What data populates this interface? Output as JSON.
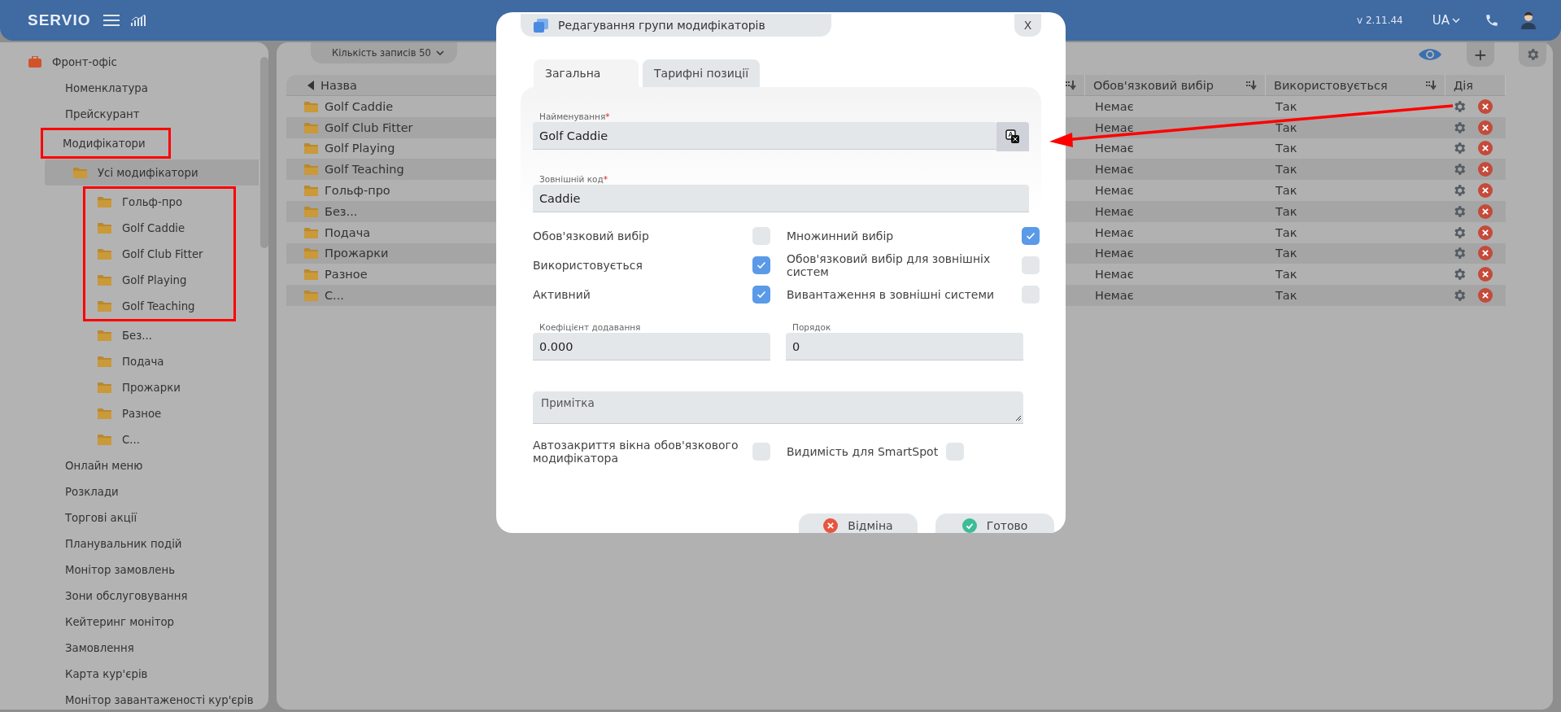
{
  "top_bar": {
    "logo": "SERVIO",
    "version": "v 2.11.44",
    "language": "UA"
  },
  "sidebar": {
    "items": [
      {
        "label": "Фронт-офіс",
        "kind": "section",
        "selected": false,
        "marked": false,
        "children": [
          {
            "label": "Номенклатура",
            "kind": "page",
            "selected": false,
            "marked": false
          },
          {
            "label": "Прейскурант",
            "kind": "page",
            "selected": false,
            "marked": false
          },
          {
            "label": "Модифікатори",
            "kind": "page",
            "selected": false,
            "marked": true,
            "children": [
              {
                "label": "Усі модифікатори",
                "kind": "folder",
                "selected": true,
                "marked": false,
                "children": [
                  {
                    "label": "Гольф-про",
                    "kind": "folder",
                    "selected": false,
                    "marked": true
                  },
                  {
                    "label": "Golf Caddie",
                    "kind": "folder",
                    "selected": false,
                    "marked": true
                  },
                  {
                    "label": "Golf Club Fitter",
                    "kind": "folder",
                    "selected": false,
                    "marked": true
                  },
                  {
                    "label": "Golf Playing",
                    "kind": "folder",
                    "selected": false,
                    "marked": true
                  },
                  {
                    "label": "Golf Teaching",
                    "kind": "folder",
                    "selected": false,
                    "marked": true
                  },
                  {
                    "label": "Без...",
                    "kind": "folder",
                    "selected": false,
                    "marked": false
                  },
                  {
                    "label": "Подача",
                    "kind": "folder",
                    "selected": false,
                    "marked": false
                  },
                  {
                    "label": "Прожарки",
                    "kind": "folder",
                    "selected": false,
                    "marked": false
                  },
                  {
                    "label": "Разное",
                    "kind": "folder",
                    "selected": false,
                    "marked": false
                  },
                  {
                    "label": "С...",
                    "kind": "folder",
                    "selected": false,
                    "marked": false
                  }
                ]
              }
            ]
          },
          {
            "label": "Онлайн меню",
            "kind": "page",
            "selected": false,
            "marked": false
          },
          {
            "label": "Розклади",
            "kind": "page",
            "selected": false,
            "marked": false
          },
          {
            "label": "Торгові акції",
            "kind": "page",
            "selected": false,
            "marked": false
          },
          {
            "label": "Планувальник подій",
            "kind": "page",
            "selected": false,
            "marked": false
          },
          {
            "label": "Монітор замовлень",
            "kind": "page",
            "selected": false,
            "marked": false
          },
          {
            "label": "Зони обслуговування",
            "kind": "page",
            "selected": false,
            "marked": false
          },
          {
            "label": "Кейтеринг монітор",
            "kind": "page",
            "selected": false,
            "marked": false
          },
          {
            "label": "Замовлення",
            "kind": "page",
            "selected": false,
            "marked": false
          },
          {
            "label": "Карта кур'єрів",
            "kind": "page",
            "selected": false,
            "marked": false
          },
          {
            "label": "Монітор завантаженості кур'єрів",
            "kind": "page",
            "selected": false,
            "marked": false
          }
        ]
      }
    ]
  },
  "toolbar": {
    "records_label": "Кількість записів",
    "records_value": "50",
    "add_button": "+"
  },
  "table": {
    "columns": [
      {
        "label": "Назва"
      },
      {
        "label": "Обов'язковий вибір",
        "sortable": true
      },
      {
        "label": "Використовується",
        "sortable": true
      },
      {
        "label": "Дія",
        "sortable": false
      }
    ],
    "rows": [
      {
        "name": "Golf Caddie",
        "required": "Немає",
        "used": "Так"
      },
      {
        "name": "Golf Club Fitter",
        "required": "Немає",
        "used": "Так"
      },
      {
        "name": "Golf Playing",
        "required": "Немає",
        "used": "Так"
      },
      {
        "name": "Golf Teaching",
        "required": "Немає",
        "used": "Так"
      },
      {
        "name": "Гольф-про",
        "required": "Немає",
        "used": "Так"
      },
      {
        "name": "Без...",
        "required": "Немає",
        "used": "Так"
      },
      {
        "name": "Подача",
        "required": "Немає",
        "used": "Так"
      },
      {
        "name": "Прожарки",
        "required": "Немає",
        "used": "Так"
      },
      {
        "name": "Разное",
        "required": "Немає",
        "used": "Так"
      },
      {
        "name": "С...",
        "required": "Немає",
        "used": "Так"
      }
    ]
  },
  "annotation_arrow": true,
  "dialog": {
    "title": "Редагування групи модифікаторів",
    "close": "X",
    "tabs": [
      {
        "label": "Загальна",
        "selected": true
      },
      {
        "label": "Тарифні позиції",
        "selected": false
      }
    ],
    "name_field": {
      "label": "Найменування",
      "required_mark": "*",
      "value": "Golf Caddie"
    },
    "code_field": {
      "label": "Зовнішній код",
      "required_mark": "*",
      "value": "Caddie"
    },
    "options": [
      {
        "label": "Обов'язковий вибір",
        "checked": false
      },
      {
        "label": "Використовується",
        "checked": true
      },
      {
        "label": "Активний",
        "checked": true
      },
      {
        "label": "Множинний вибір",
        "checked": true
      },
      {
        "label": "Обов'язковий вибір для зовнішніх систем",
        "checked": false
      },
      {
        "label": "Вивантаження в зовнішні системи",
        "checked": false
      }
    ],
    "coef_field": {
      "label": "Коефіцієнт додавання",
      "value": "0.000"
    },
    "order_field": {
      "label": "Порядок",
      "value": "0"
    },
    "note_field": {
      "placeholder": "Примітка"
    },
    "autoclose": {
      "label": "Автозакриття вікна обов'язкового модифікатора",
      "checked": false
    },
    "smartspot": {
      "label": "Видимість для SmartSpot",
      "checked": false
    },
    "buttons": [
      {
        "label": "Відміна",
        "kind": "cancel"
      },
      {
        "label": "Готово",
        "kind": "ok"
      }
    ]
  }
}
